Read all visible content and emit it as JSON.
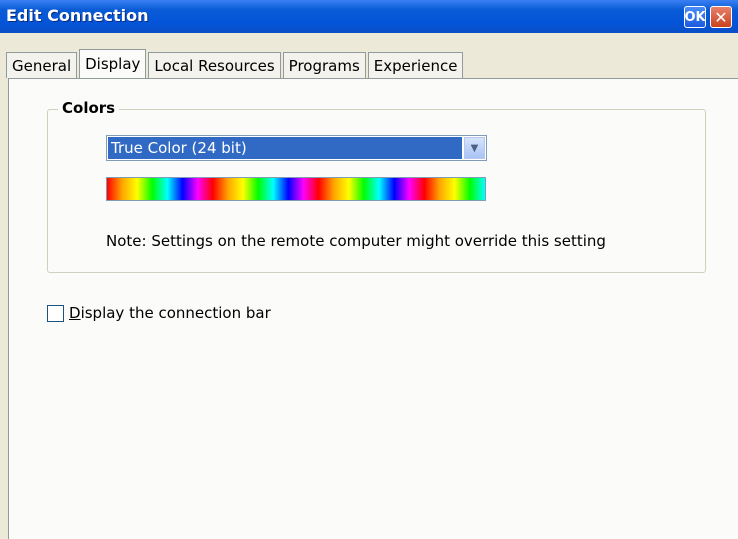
{
  "window": {
    "title": "Edit Connection",
    "ok_label": "OK",
    "close_glyph": "✕"
  },
  "tabs": [
    {
      "label": "General"
    },
    {
      "label": "Display",
      "active": true
    },
    {
      "label": "Local Resources"
    },
    {
      "label": "Programs"
    },
    {
      "label": "Experience"
    }
  ],
  "colors": {
    "group_label": "Colors",
    "selected": "True Color (24 bit)",
    "note": "Note: Settings on the remote computer might override this setting"
  },
  "options": {
    "connection_bar_mnemonic": "D",
    "connection_bar_rest": "isplay the connection bar",
    "connection_bar_checked": false
  },
  "theme": {
    "titlebar": "#0454d9",
    "selection": "#316ac5",
    "background": "#ece9d8"
  }
}
